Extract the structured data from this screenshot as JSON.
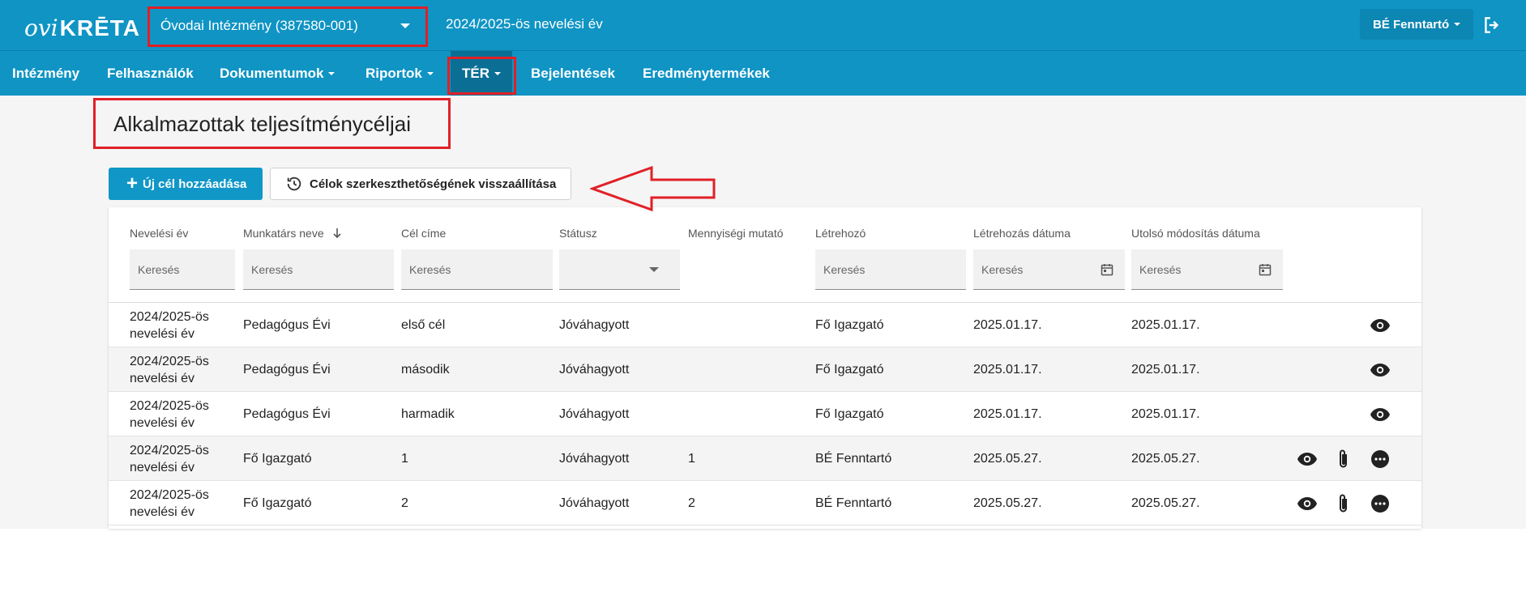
{
  "header": {
    "logo_prefix": "ovi",
    "logo_brand": "KRĒTA",
    "institution": "Óvodai Intézmény (387580-001)",
    "school_year": "2024/2025-ös nevelési év",
    "user": "BÉ Fenntartó"
  },
  "nav": {
    "items": [
      {
        "label": "Intézmény"
      },
      {
        "label": "Felhasználók"
      },
      {
        "label": "Dokumentumok"
      },
      {
        "label": "Riportok"
      },
      {
        "label": "TÉR"
      },
      {
        "label": "Bejelentések"
      },
      {
        "label": "Eredménytermékek"
      }
    ]
  },
  "page": {
    "title": "Alkalmazottak teljesítménycéljai",
    "add_button": "Új cél hozzáadása",
    "restore_button": "Célok szerkeszthetőségének visszaállítása"
  },
  "table": {
    "columns": [
      "Nevelési év",
      "Munkatárs neve",
      "Cél címe",
      "Státusz",
      "Mennyiségi mutató",
      "Létrehozó",
      "Létrehozás dátuma",
      "Utolsó módosítás dátuma"
    ],
    "filter_placeholder": "Keresés",
    "rows": [
      {
        "year_line1": "2024/2025-ös",
        "year_line2": "nevelési év",
        "employee": "Pedagógus Évi",
        "goal": "első cél",
        "status": "Jóváhagyott",
        "quantity": "",
        "creator": "Fő Igazgató",
        "created": "2025.01.17.",
        "modified": "2025.01.17."
      },
      {
        "year_line1": "2024/2025-ös",
        "year_line2": "nevelési év",
        "employee": "Pedagógus Évi",
        "goal": "második",
        "status": "Jóváhagyott",
        "quantity": "",
        "creator": "Fő Igazgató",
        "created": "2025.01.17.",
        "modified": "2025.01.17."
      },
      {
        "year_line1": "2024/2025-ös",
        "year_line2": "nevelési év",
        "employee": "Pedagógus Évi",
        "goal": "harmadik",
        "status": "Jóváhagyott",
        "quantity": "",
        "creator": "Fő Igazgató",
        "created": "2025.01.17.",
        "modified": "2025.01.17."
      },
      {
        "year_line1": "2024/2025-ös",
        "year_line2": "nevelési év",
        "employee": "Fő Igazgató",
        "goal": "1",
        "status": "Jóváhagyott",
        "quantity": "1",
        "creator": "BÉ Fenntartó",
        "created": "2025.05.27.",
        "modified": "2025.05.27."
      },
      {
        "year_line1": "2024/2025-ös",
        "year_line2": "nevelési év",
        "employee": "Fő Igazgató",
        "goal": "2",
        "status": "Jóváhagyott",
        "quantity": "2",
        "creator": "BÉ Fenntartó",
        "created": "2025.05.27.",
        "modified": "2025.05.27."
      }
    ]
  },
  "icons": {
    "view": "eye-icon",
    "attach": "paperclip-icon",
    "more": "more-icon",
    "sort": "arrow-down-icon",
    "calendar": "calendar-icon",
    "restore": "history-icon",
    "logout": "logout-icon"
  },
  "colors": {
    "primary": "#0f94c4",
    "nav_active": "#0b6f95",
    "annotation": "#e02026"
  }
}
